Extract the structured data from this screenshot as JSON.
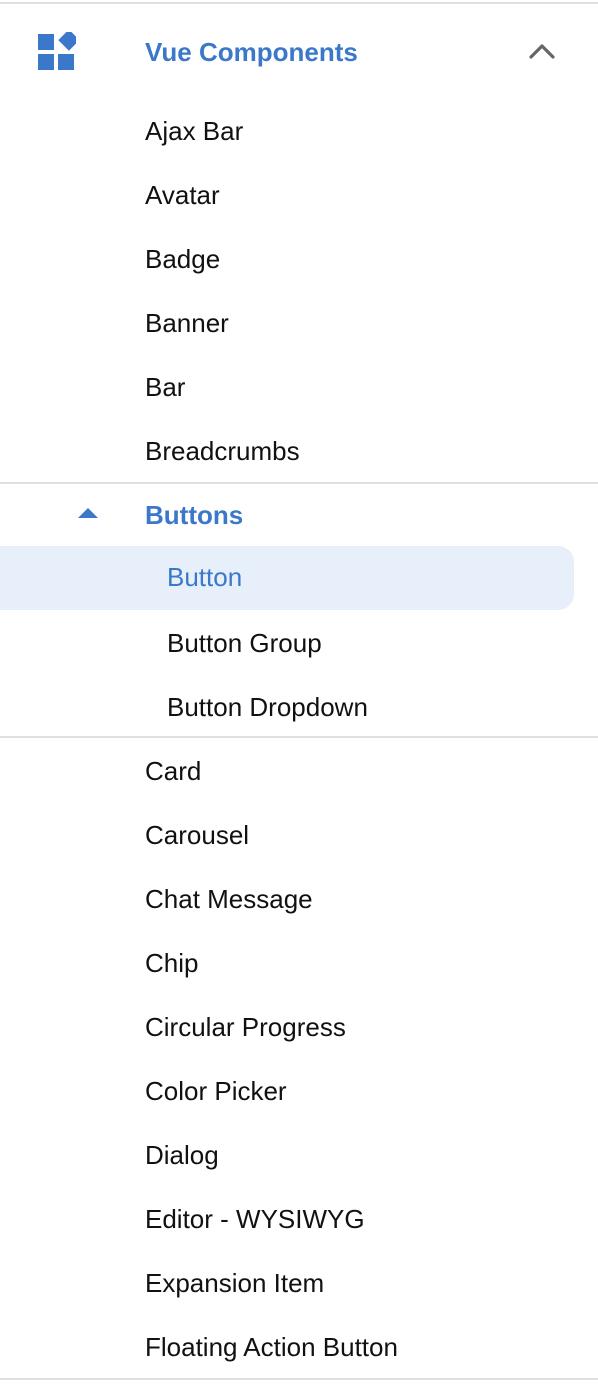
{
  "section": {
    "title": "Vue Components",
    "icon": "widgets-icon",
    "collapse_icon": "chevron-up-icon",
    "accent_color": "#3b78c9"
  },
  "items_before": [
    {
      "label": "Ajax Bar"
    },
    {
      "label": "Avatar"
    },
    {
      "label": "Badge"
    },
    {
      "label": "Banner"
    },
    {
      "label": "Bar"
    },
    {
      "label": "Breadcrumbs"
    }
  ],
  "buttons_group": {
    "label": "Buttons",
    "icon": "caret-up-icon",
    "items": [
      {
        "label": "Button",
        "active": true
      },
      {
        "label": "Button Group"
      },
      {
        "label": "Button Dropdown"
      }
    ]
  },
  "items_after": [
    {
      "label": "Card"
    },
    {
      "label": "Carousel"
    },
    {
      "label": "Chat Message"
    },
    {
      "label": "Chip"
    },
    {
      "label": "Circular Progress"
    },
    {
      "label": "Color Picker"
    },
    {
      "label": "Dialog"
    },
    {
      "label": "Editor - WYSIWYG"
    },
    {
      "label": "Expansion Item"
    },
    {
      "label": "Floating Action Button"
    }
  ],
  "colors": {
    "active_background": "#e6effa",
    "text": "#111111",
    "divider": "#e0e0e0"
  }
}
